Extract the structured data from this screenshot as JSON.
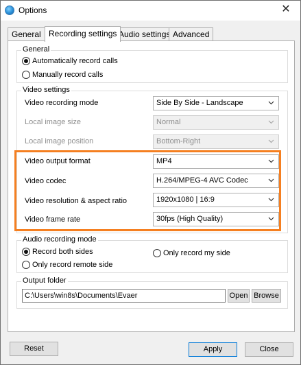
{
  "window": {
    "title": "Options",
    "close_symbol": "✕"
  },
  "tabs": [
    {
      "label": "General",
      "active": false
    },
    {
      "label": "Recording settings",
      "active": true
    },
    {
      "label": "Audio settings",
      "active": false
    },
    {
      "label": "Advanced",
      "active": false
    }
  ],
  "general_group": {
    "title": "General",
    "options": [
      {
        "label": "Automatically record calls",
        "checked": true
      },
      {
        "label": "Manually record calls",
        "checked": false
      }
    ]
  },
  "video_group": {
    "title": "Video settings",
    "rows": [
      {
        "label": "Video recording mode",
        "value": "Side By Side - Landscape",
        "enabled": true
      },
      {
        "label": "Local image size",
        "value": "Normal",
        "enabled": false
      },
      {
        "label": "Local image position",
        "value": "Bottom-Right",
        "enabled": false
      },
      {
        "label": "Video output format",
        "value": "MP4",
        "enabled": true
      },
      {
        "label": "Video codec",
        "value": "H.264/MPEG-4 AVC Codec",
        "enabled": true
      },
      {
        "label": "Video resolution & aspect ratio",
        "value": "1920x1080 | 16:9",
        "enabled": true
      },
      {
        "label": "Video frame rate",
        "value": "30fps (High Quality)",
        "enabled": true
      }
    ],
    "highlight_color": "#f57f20"
  },
  "audio_group": {
    "title": "Audio recording mode",
    "options": [
      {
        "label": "Record both sides",
        "checked": true
      },
      {
        "label": "Only record my side",
        "checked": false
      },
      {
        "label": "Only record remote side",
        "checked": false
      }
    ]
  },
  "output_group": {
    "title": "Output folder",
    "path": "C:\\Users\\win8s\\Documents\\Evaer",
    "open_label": "Open",
    "browse_label": "Browse"
  },
  "footer": {
    "reset_label": "Reset",
    "apply_label": "Apply",
    "close_label": "Close"
  }
}
